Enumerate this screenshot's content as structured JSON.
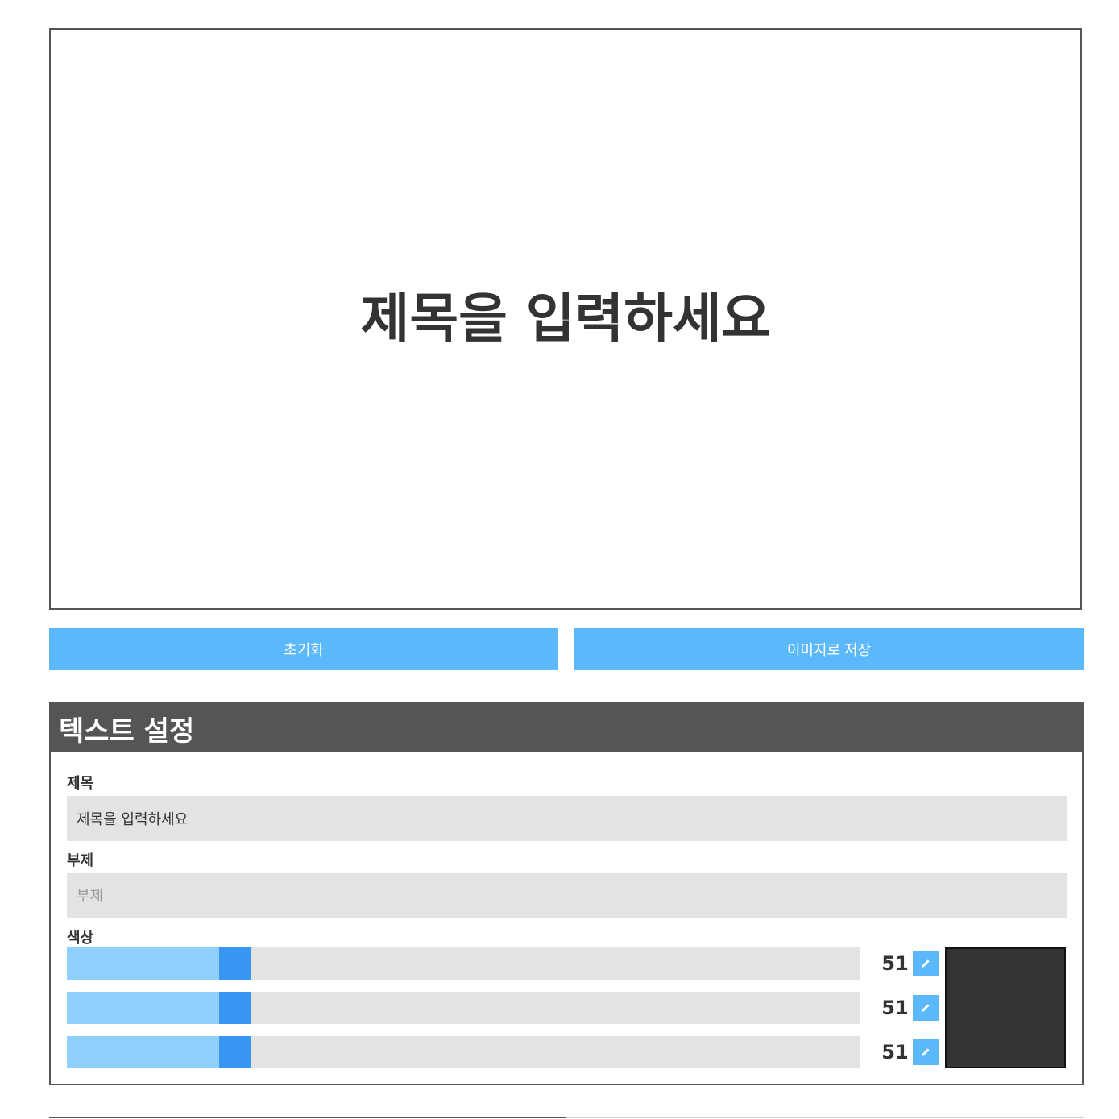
{
  "preview": {
    "title": "제목을 입력하세요",
    "subtitle": ""
  },
  "actions": {
    "reset_label": "초기화",
    "save_label": "이미지로 저장"
  },
  "panel": {
    "header": "텍스트 설정",
    "title_label": "제목",
    "title_value": "제목을 입력하세요",
    "subtitle_label": "부제",
    "subtitle_placeholder": "부제",
    "color_label": "색상",
    "color": {
      "r": 51,
      "g": 51,
      "b": 51,
      "max": 255,
      "hex": "#333333"
    }
  },
  "colors": {
    "accent": "#5bb8fa",
    "slider_fill": "#90cffc",
    "slider_thumb": "#3796f2",
    "header_bg": "#555555"
  },
  "icons": {
    "edit": "pencil-icon"
  }
}
